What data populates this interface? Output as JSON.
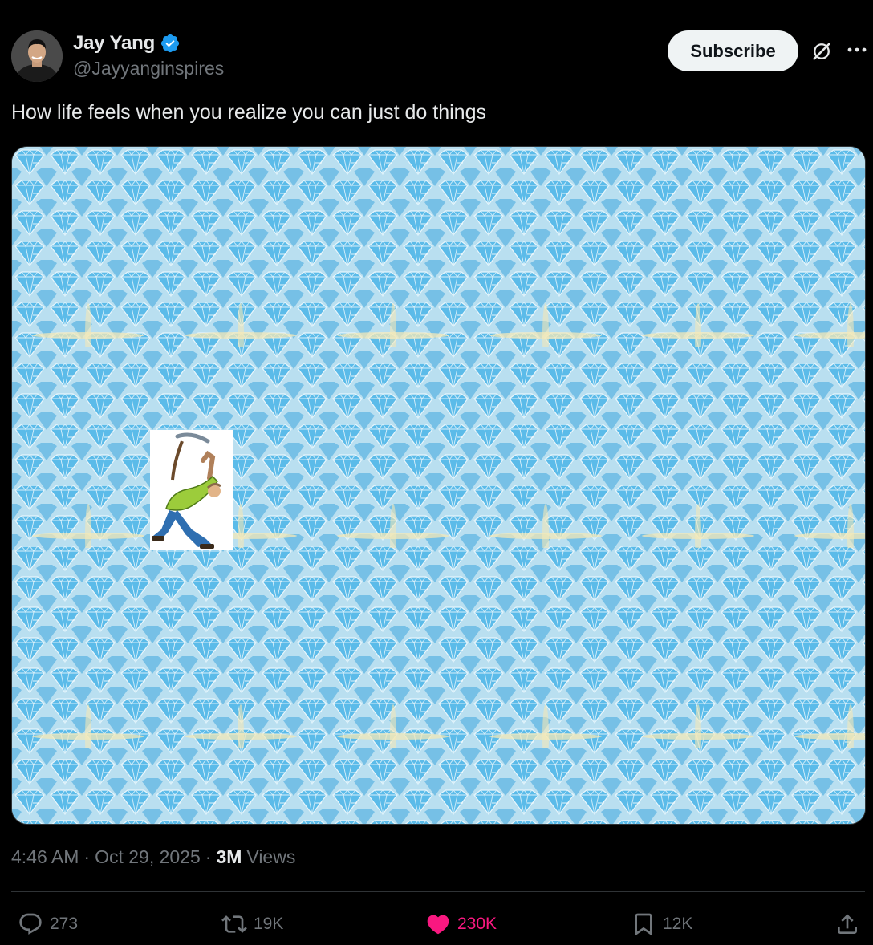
{
  "author": {
    "display_name": "Jay Yang",
    "handle": "@Jayyanginspires",
    "verified": true,
    "verified_color": "#1d9bf0"
  },
  "header": {
    "subscribe_label": "Subscribe",
    "icons": [
      "grok-icon",
      "more-icon"
    ]
  },
  "post": {
    "text": "How life feels when you realize you can just do things",
    "media": {
      "description_icons": [
        "diamond-pattern",
        "miner-with-pickaxe"
      ],
      "background_color": "#a9d6ea",
      "diamond_color": "#4fb3e6"
    }
  },
  "meta": {
    "time": "4:46 AM",
    "date": "Oct 29, 2025",
    "views_count": "3M",
    "views_label": "Views"
  },
  "actions": {
    "replies": "273",
    "reposts": "19K",
    "likes": "230K",
    "bookmarks": "12K",
    "like_color": "#f91880",
    "icons": [
      "reply-icon",
      "repost-icon",
      "heart-icon",
      "bookmark-icon",
      "share-icon"
    ]
  }
}
